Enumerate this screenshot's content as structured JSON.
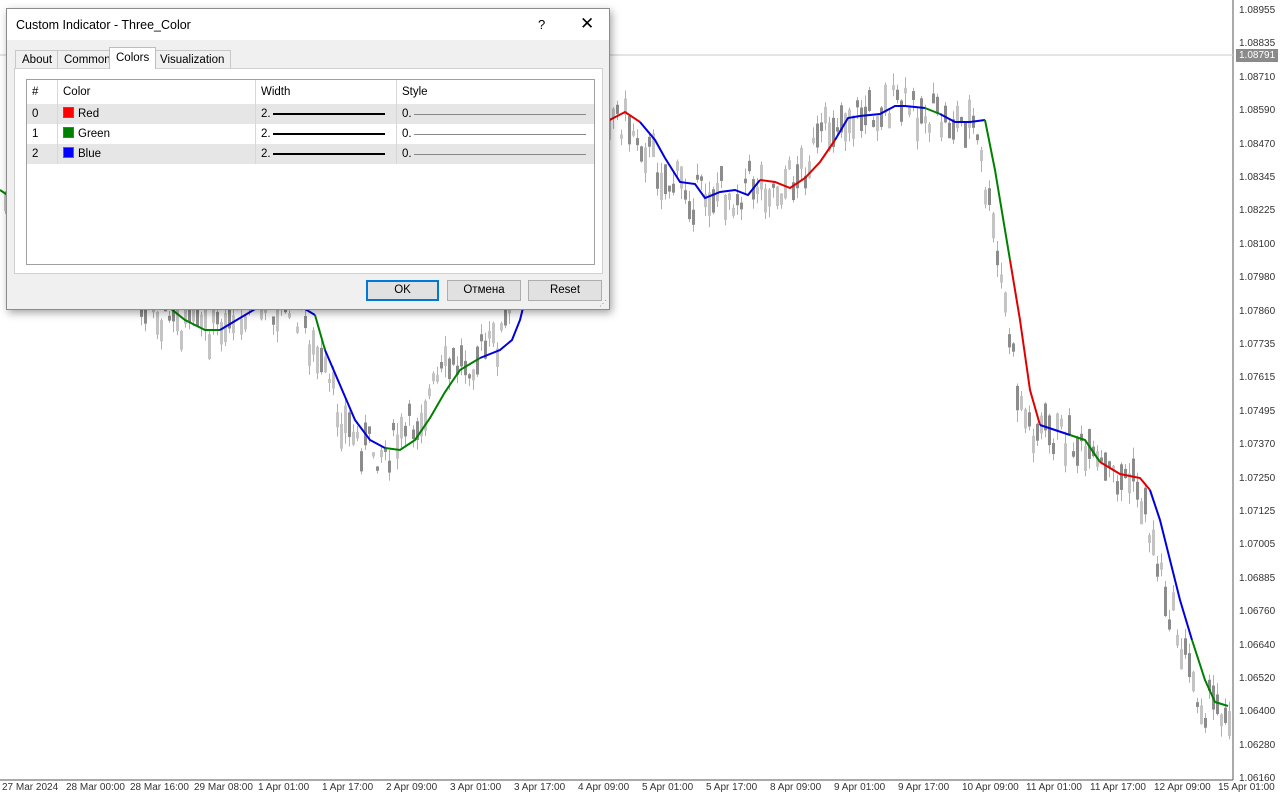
{
  "chart": {
    "price_scale": [
      "1.08955",
      "1.08835",
      "1.08710",
      "1.08590",
      "1.08470",
      "1.08345",
      "1.08225",
      "1.08100",
      "1.07980",
      "1.07860",
      "1.07735",
      "1.07615",
      "1.07495",
      "1.07370",
      "1.07250",
      "1.07125",
      "1.07005",
      "1.06885",
      "1.06760",
      "1.06640",
      "1.06520",
      "1.06400",
      "1.06280",
      "1.06160"
    ],
    "current_price": "1.08791",
    "time_scale": [
      "27 Mar 2024",
      "28 Mar 00:00",
      "28 Mar 16:00",
      "29 Mar 08:00",
      "1 Apr 01:00",
      "1 Apr 17:00",
      "2 Apr 09:00",
      "3 Apr 01:00",
      "3 Apr 17:00",
      "4 Apr 09:00",
      "5 Apr 01:00",
      "5 Apr 17:00",
      "8 Apr 09:00",
      "9 Apr 01:00",
      "9 Apr 17:00",
      "10 Apr 09:00",
      "11 Apr 01:00",
      "11 Apr 17:00",
      "12 Apr 09:00",
      "15 Apr 01:00"
    ],
    "colors": {
      "line_red": "#e00000",
      "line_green": "#008000",
      "line_blue": "#0000e0",
      "candle": "#8c8c8c",
      "candle_light": "#c4c4c4"
    }
  },
  "dialog": {
    "title": "Custom Indicator - Three_Color",
    "help": "?",
    "close": "✕",
    "tabs": [
      {
        "label": "About",
        "active": false
      },
      {
        "label": "Common",
        "active": false
      },
      {
        "label": "Colors",
        "active": true
      },
      {
        "label": "Visualization",
        "active": false
      }
    ],
    "table": {
      "headers": [
        "#",
        "Color",
        "Width",
        "Style"
      ],
      "rows": [
        {
          "index": "0",
          "color_name": "Red",
          "color": "#ff0000",
          "width": "2.",
          "style": "0."
        },
        {
          "index": "1",
          "color_name": "Green",
          "color": "#008000",
          "width": "2.",
          "style": "0."
        },
        {
          "index": "2",
          "color_name": "Blue",
          "color": "#0000ff",
          "width": "2.",
          "style": "0."
        }
      ]
    },
    "buttons": {
      "ok": "OK",
      "cancel": "Отмена",
      "reset": "Reset"
    }
  }
}
